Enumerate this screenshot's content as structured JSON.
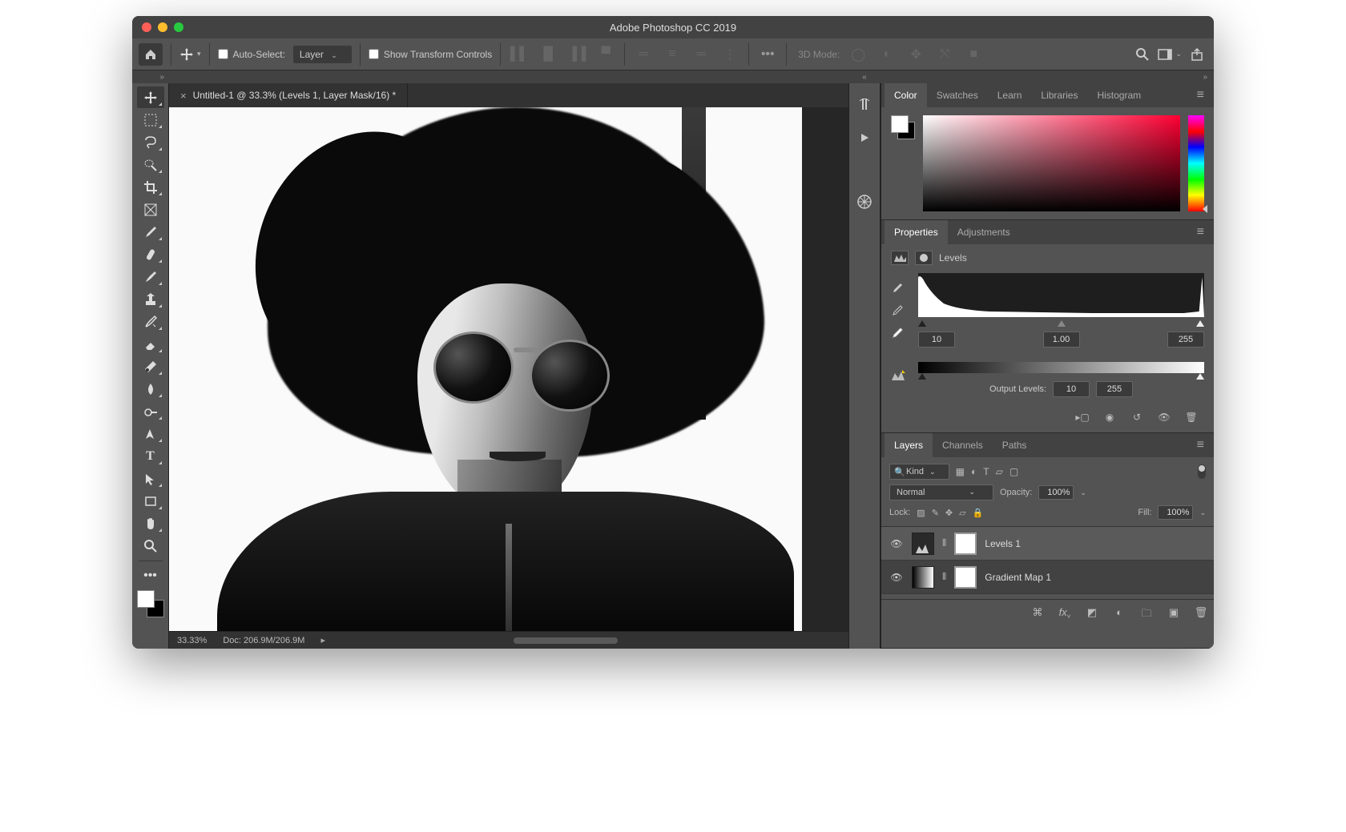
{
  "app": {
    "title": "Adobe Photoshop CC 2019"
  },
  "options": {
    "autoSelectLabel": "Auto-Select:",
    "autoSelectChecked": false,
    "autoSelectTarget": "Layer",
    "showTransformLabel": "Show Transform Controls",
    "showTransformChecked": false,
    "threeDModeLabel": "3D Mode:"
  },
  "document": {
    "tabTitle": "Untitled-1 @ 33.3% (Levels 1, Layer Mask/16) *",
    "zoomText": "33.33%",
    "docInfo": "Doc: 206.9M/206.9M"
  },
  "panelTabs": {
    "color": [
      "Color",
      "Swatches",
      "Learn",
      "Libraries",
      "Histogram"
    ],
    "props": [
      "Properties",
      "Adjustments"
    ],
    "layers": [
      "Layers",
      "Channels",
      "Paths"
    ]
  },
  "properties": {
    "title": "Levels",
    "inputBlack": "10",
    "inputGamma": "1.00",
    "inputWhite": "255",
    "outputLabel": "Output Levels:",
    "outputBlack": "10",
    "outputWhite": "255"
  },
  "layers": {
    "kindLabel": "Kind",
    "blendMode": "Normal",
    "opacityLabel": "Opacity:",
    "opacityValue": "100%",
    "lockLabel": "Lock:",
    "fillLabel": "Fill:",
    "fillValue": "100%",
    "items": [
      {
        "name": "Levels 1",
        "type": "levels",
        "selected": true,
        "visible": true
      },
      {
        "name": "Gradient Map 1",
        "type": "gradientMap",
        "selected": false,
        "visible": true
      }
    ]
  }
}
